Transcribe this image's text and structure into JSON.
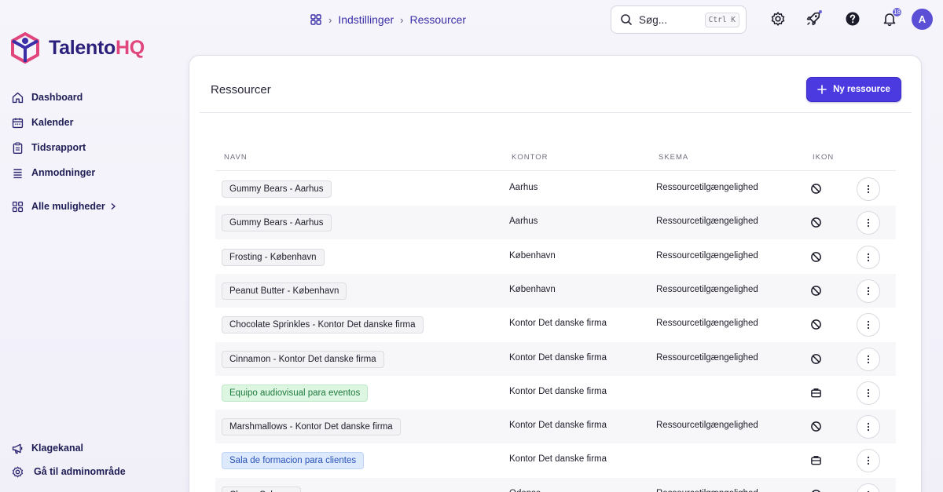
{
  "brand": {
    "name_main": "Talento",
    "name_accent": "HQ"
  },
  "sidebar": {
    "items": [
      {
        "label": "Dashboard",
        "icon": "home-icon"
      },
      {
        "label": "Kalender",
        "icon": "calendar-icon"
      },
      {
        "label": "Tidsrapport",
        "icon": "clipboard-icon"
      },
      {
        "label": "Anmodninger",
        "icon": "list-icon"
      }
    ],
    "more": {
      "label": "Alle muligheder",
      "icon": "grid-icon"
    },
    "bottom": [
      {
        "label": "Klagekanal",
        "icon": "megaphone-icon"
      },
      {
        "label": "Gå til adminområde",
        "icon": "gear-icon"
      }
    ]
  },
  "breadcrumb": {
    "items": [
      "Indstillinger",
      "Ressourcer"
    ]
  },
  "search": {
    "placeholder": "Søg...",
    "shortcut": "Ctrl K"
  },
  "header": {
    "notification_count": "18",
    "avatar_initial": "A"
  },
  "page": {
    "title": "Ressourcer",
    "new_button": "Ny ressource"
  },
  "table": {
    "columns": [
      "NAVN",
      "KONTOR",
      "SKEMA",
      "IKON"
    ],
    "rows": [
      {
        "name": "Gummy Bears - Aarhus",
        "office": "Aarhus",
        "schedule": "Ressourcetilgængelighed",
        "icon": "ban-icon",
        "tag_color": "gray"
      },
      {
        "name": "Gummy Bears - Aarhus",
        "office": "Aarhus",
        "schedule": "Ressourcetilgængelighed",
        "icon": "ban-icon",
        "tag_color": "gray"
      },
      {
        "name": "Frosting - København",
        "office": "København",
        "schedule": "Ressourcetilgængelighed",
        "icon": "ban-icon",
        "tag_color": "gray"
      },
      {
        "name": "Peanut Butter - København",
        "office": "København",
        "schedule": "Ressourcetilgængelighed",
        "icon": "ban-icon",
        "tag_color": "gray"
      },
      {
        "name": "Chocolate Sprinkles - Kontor Det danske firma",
        "office": "Kontor Det danske firma",
        "schedule": "Ressourcetilgængelighed",
        "icon": "ban-icon",
        "tag_color": "gray"
      },
      {
        "name": "Cinnamon - Kontor Det danske firma",
        "office": "Kontor Det danske firma",
        "schedule": "Ressourcetilgængelighed",
        "icon": "ban-icon",
        "tag_color": "gray"
      },
      {
        "name": "Equipo audiovisual para eventos",
        "office": "Kontor Det danske firma",
        "schedule": "",
        "icon": "briefcase-icon",
        "tag_color": "green"
      },
      {
        "name": "Marshmallows - Kontor Det danske firma",
        "office": "Kontor Det danske firma",
        "schedule": "Ressourcetilgængelighed",
        "icon": "ban-icon",
        "tag_color": "gray"
      },
      {
        "name": "Sala de formacion para clientes",
        "office": "Kontor Det danske firma",
        "schedule": "",
        "icon": "briefcase-icon",
        "tag_color": "blue"
      },
      {
        "name": "Cherry Cola - ...",
        "office": "Odense",
        "schedule": "Ressourcetilgængelighed",
        "icon": "ban-icon",
        "tag_color": "gray"
      }
    ]
  }
}
